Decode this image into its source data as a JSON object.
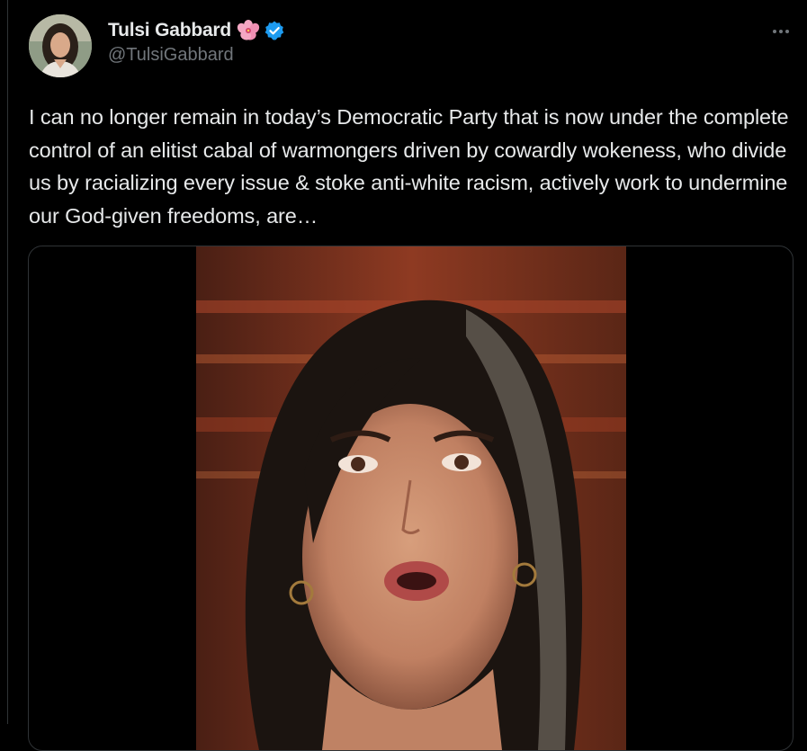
{
  "author": {
    "display_name": "Tulsi Gabbard",
    "handle": "@TulsiGabbard",
    "emoji": "hibiscus-emoji",
    "verified": true,
    "verified_color": "#1d9bf0"
  },
  "post": {
    "text": "I can no longer remain in today’s Democratic Party that is now under the complete control of an elitist cabal of warmongers driven by cowardly wokeness, who divide us by racializing every issue & stoke anti-white racism, actively work to undermine our God-given freedoms, are…"
  },
  "media": {
    "type": "video",
    "thumbnail_icon": "video-thumbnail"
  },
  "icons": {
    "more": "more-icon"
  },
  "colors": {
    "background": "#000000",
    "text_primary": "#e7e9ea",
    "text_secondary": "#71767b",
    "border": "#2f3336"
  }
}
